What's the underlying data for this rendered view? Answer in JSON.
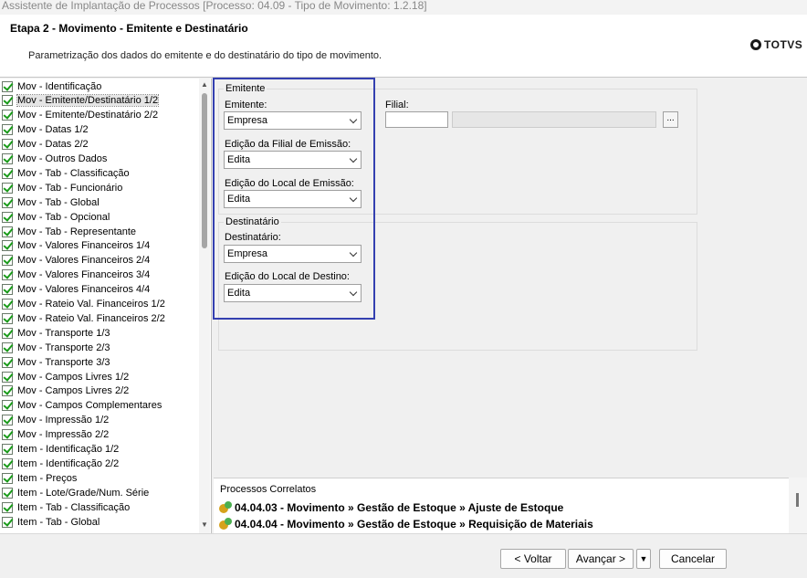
{
  "window": {
    "title": "Assistente de Implantação de Processos [Processo: 04.09 - Tipo de Movimento: 1.2.18]"
  },
  "header": {
    "step_title": "Etapa 2 - Movimento - Emitente e Destinatário",
    "description": "Parametrização dos dados do emitente e do destinatário do tipo de movimento.",
    "logo_text": "TOTVS"
  },
  "tree": {
    "items": [
      {
        "label": "Mov - Identificação"
      },
      {
        "label": "Mov - Emitente/Destinatário 1/2",
        "selected": true
      },
      {
        "label": "Mov - Emitente/Destinatário 2/2"
      },
      {
        "label": "Mov - Datas 1/2"
      },
      {
        "label": "Mov - Datas 2/2"
      },
      {
        "label": "Mov - Outros Dados"
      },
      {
        "label": "Mov - Tab - Classificação"
      },
      {
        "label": "Mov - Tab - Funcionário"
      },
      {
        "label": "Mov - Tab - Global"
      },
      {
        "label": "Mov - Tab - Opcional"
      },
      {
        "label": "Mov - Tab - Representante"
      },
      {
        "label": "Mov - Valores Financeiros 1/4"
      },
      {
        "label": "Mov - Valores Financeiros 2/4"
      },
      {
        "label": "Mov - Valores Financeiros 3/4"
      },
      {
        "label": "Mov - Valores Financeiros 4/4"
      },
      {
        "label": "Mov - Rateio Val. Financeiros 1/2"
      },
      {
        "label": "Mov - Rateio Val. Financeiros 2/2"
      },
      {
        "label": "Mov - Transporte 1/3"
      },
      {
        "label": "Mov - Transporte 2/3"
      },
      {
        "label": "Mov - Transporte 3/3"
      },
      {
        "label": "Mov - Campos Livres 1/2"
      },
      {
        "label": "Mov - Campos Livres 2/2"
      },
      {
        "label": "Mov - Campos Complementares"
      },
      {
        "label": "Mov - Impressão 1/2"
      },
      {
        "label": "Mov - Impressão 2/2"
      },
      {
        "label": "Item - Identificação 1/2"
      },
      {
        "label": "Item - Identificação 2/2"
      },
      {
        "label": "Item - Preços"
      },
      {
        "label": "Item - Lote/Grade/Num. Série"
      },
      {
        "label": "Item - Tab - Classificação"
      },
      {
        "label": "Item - Tab - Global"
      }
    ]
  },
  "emitente": {
    "legend": "Emitente",
    "emitente_label": "Emitente:",
    "emitente_value": "Empresa",
    "filial_label": "Filial:",
    "filial_button": "...",
    "edicao_filial_label": "Edição da Filial de Emissão:",
    "edicao_filial_value": "Edita",
    "edicao_local_label": "Edição do Local de Emissão:",
    "edicao_local_value": "Edita"
  },
  "destinatario": {
    "legend": "Destinatário",
    "destinatario_label": "Destinatário:",
    "destinatario_value": "Empresa",
    "edicao_local_label": "Edição do Local de Destino:",
    "edicao_local_value": "Edita"
  },
  "related": {
    "title": "Processos Correlatos",
    "items": [
      {
        "label": "04.04.03 - Movimento » Gestão de Estoque » Ajuste de Estoque"
      },
      {
        "label": "04.04.04 - Movimento » Gestão de Estoque » Requisição de Materiais"
      }
    ]
  },
  "footer": {
    "back_label": "< Voltar",
    "next_label": "Avançar >",
    "dropdown_label": "▼",
    "cancel_label": "Cancelar"
  },
  "colors": {
    "highlight_border": "#3440b0",
    "check_green": "#1a9b1a"
  }
}
